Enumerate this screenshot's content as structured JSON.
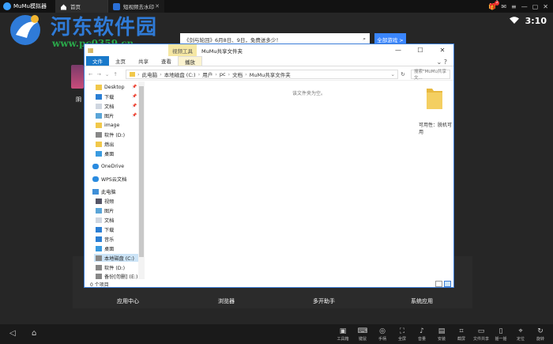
{
  "app": {
    "name": "MuMu模拟器"
  },
  "tabs": [
    {
      "label": "首页",
      "active": true
    },
    {
      "label": "短视频去水印",
      "active": false
    }
  ],
  "topbar": {
    "notification_count": "2"
  },
  "status": {
    "time": "3:10"
  },
  "watermark": {
    "name": "河东软件园",
    "url": "www.pc0359.cn"
  },
  "search": {
    "placeholder": "《剑与轮回》6月8日、9日，免费送多少！"
  },
  "buttons": {
    "all_games": "全部游戏 >"
  },
  "desktop": {
    "partial_label": "阴"
  },
  "dock": [
    "应用中心",
    "浏览器",
    "多开助手",
    "系统应用"
  ],
  "toolbar": [
    {
      "label": "工具箱",
      "icon": "toolbox-icon"
    },
    {
      "label": "键鼠",
      "icon": "keyboard-icon"
    },
    {
      "label": "手柄",
      "icon": "gamepad-icon"
    },
    {
      "label": "全屏",
      "icon": "fullscreen-icon"
    },
    {
      "label": "音量",
      "icon": "volume-icon"
    },
    {
      "label": "安装",
      "icon": "apk-icon"
    },
    {
      "label": "截屏",
      "icon": "crop-icon"
    },
    {
      "label": "文件共享",
      "icon": "folder-icon"
    },
    {
      "label": "摇一摇",
      "icon": "shake-icon"
    },
    {
      "label": "定位",
      "icon": "location-icon"
    },
    {
      "label": "旋转",
      "icon": "rotate-icon"
    }
  ],
  "explorer": {
    "title": "MuMu共享文件夹",
    "context_tab": "视频工具",
    "ribbon_tabs": [
      "文件",
      "主页",
      "共享",
      "查看",
      "播放"
    ],
    "address": [
      "此电脑",
      "本地磁盘 (C:)",
      "用户",
      "pc",
      "文档",
      "MuMu共享文件夹"
    ],
    "search_placeholder": "搜索\"MuMu共享文...",
    "nav_items": [
      "Desktop",
      "下载",
      "文档",
      "图片",
      "image",
      "软件 (D:)",
      "燃出",
      "桌面",
      "OneDrive",
      "WPS云文档",
      "此电脑",
      "视频",
      "图片",
      "文档",
      "下载",
      "音乐",
      "桌面",
      "本地磁盘 (C:)",
      "软件 (D:)",
      "备份[勿删] (E:)"
    ],
    "empty_text": "该文件夹为空。",
    "folder_label": "可用性：脱机可用",
    "status_text": "0 个项目"
  }
}
